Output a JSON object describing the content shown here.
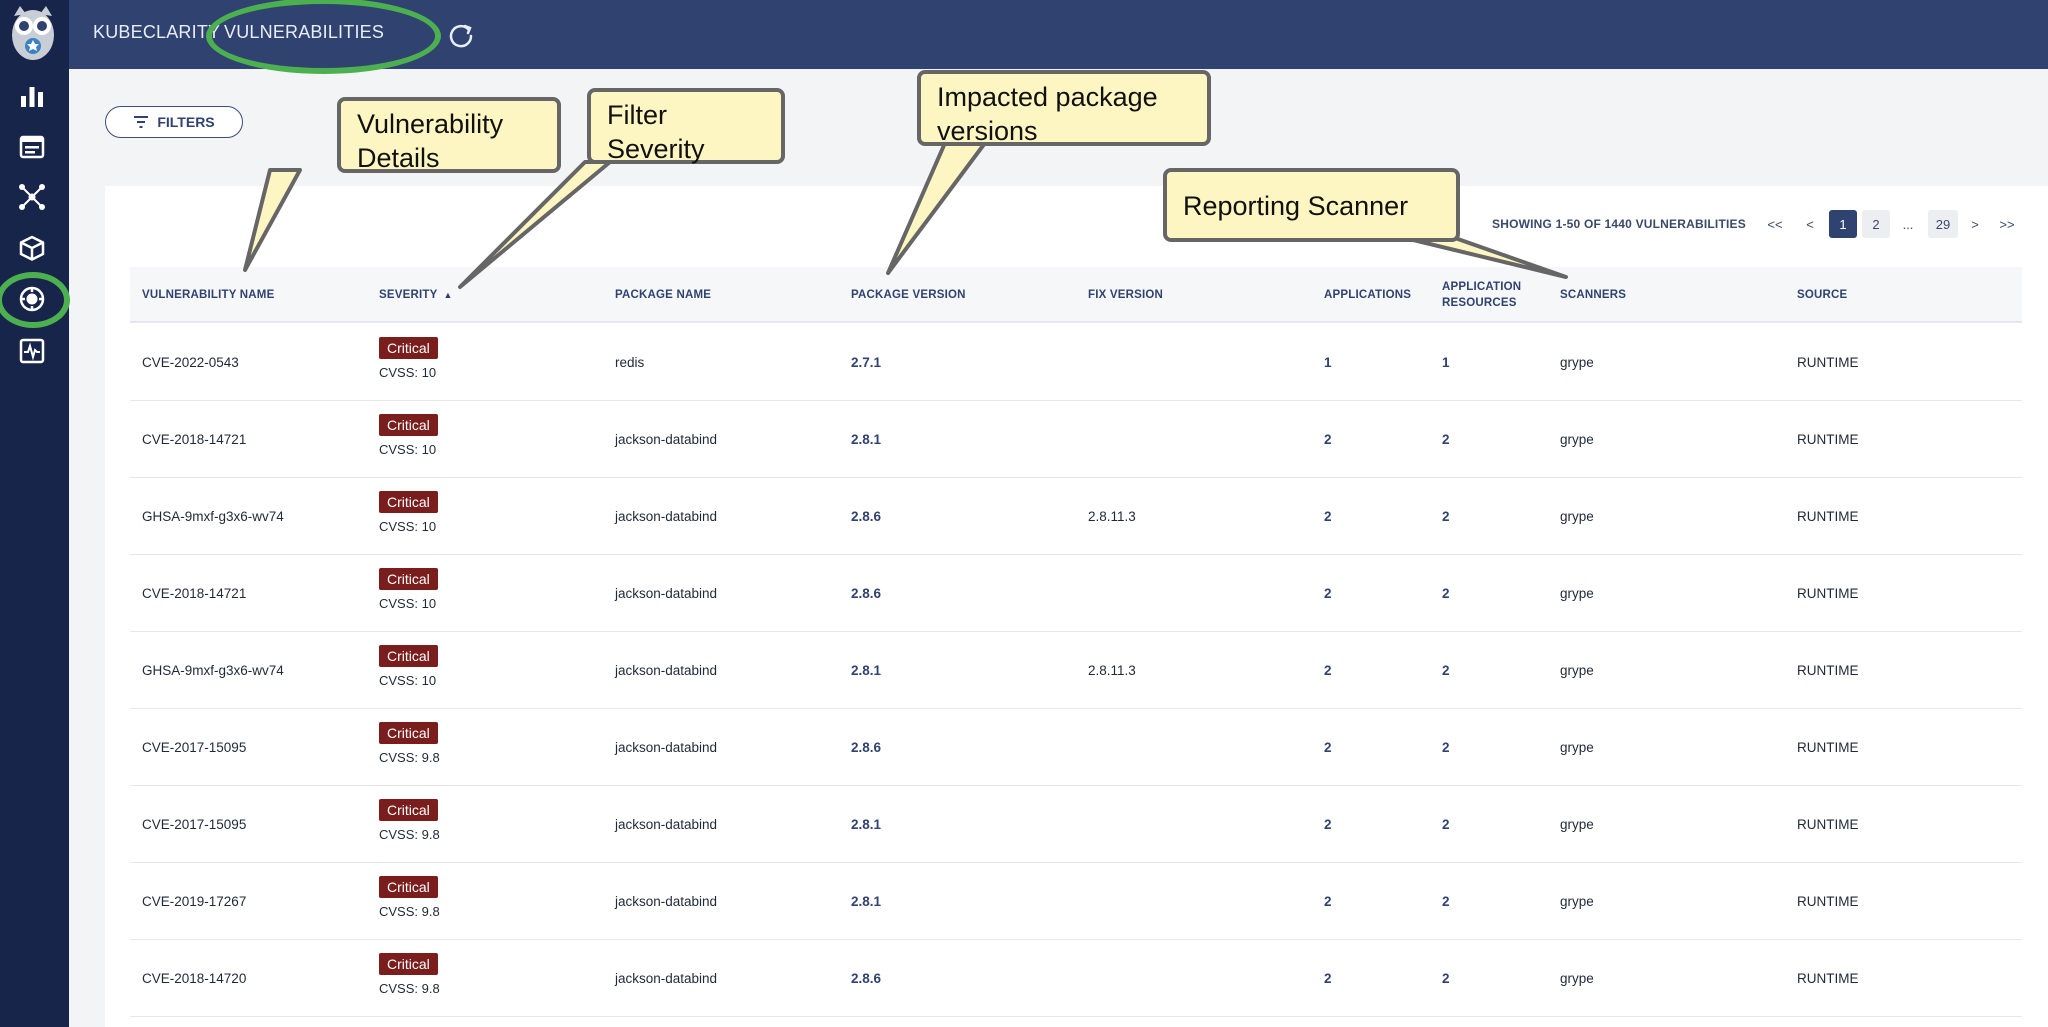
{
  "header": {
    "breadcrumb_root": "KUBECLARITY",
    "breadcrumb_current": "VULNERABILITIES"
  },
  "sidebar": {
    "items": [
      {
        "icon": "bar-chart-icon"
      },
      {
        "icon": "applications-icon"
      },
      {
        "icon": "network-icon"
      },
      {
        "icon": "package-icon"
      },
      {
        "icon": "vulnerability-icon",
        "active": true
      },
      {
        "icon": "runtime-scan-icon"
      }
    ]
  },
  "toolbar": {
    "filters_label": "FILTERS"
  },
  "pagination": {
    "summary": "SHOWING 1-50 OF 1440 VULNERABILITIES",
    "first": "<<",
    "prev": "<",
    "pages": [
      "1",
      "2",
      "...",
      "29"
    ],
    "active_page": "1",
    "next": ">",
    "last": ">>"
  },
  "table": {
    "columns": [
      "VULNERABILITY NAME",
      "SEVERITY",
      "PACKAGE NAME",
      "PACKAGE VERSION",
      "FIX VERSION",
      "APPLICATIONS",
      "APPLICATION RESOURCES",
      "SCANNERS",
      "SOURCE"
    ],
    "sort_indicator": "▲",
    "rows": [
      {
        "name": "CVE-2022-0543",
        "severity": "Critical",
        "cvss": "CVSS: 10",
        "package": "redis",
        "version": "2.7.1",
        "fix": "",
        "apps": "1",
        "resources": "1",
        "scanners": "grype",
        "source": "RUNTIME"
      },
      {
        "name": "CVE-2018-14721",
        "severity": "Critical",
        "cvss": "CVSS: 10",
        "package": "jackson-databind",
        "version": "2.8.1",
        "fix": "",
        "apps": "2",
        "resources": "2",
        "scanners": "grype",
        "source": "RUNTIME"
      },
      {
        "name": "GHSA-9mxf-g3x6-wv74",
        "severity": "Critical",
        "cvss": "CVSS: 10",
        "package": "jackson-databind",
        "version": "2.8.6",
        "fix": "2.8.11.3",
        "apps": "2",
        "resources": "2",
        "scanners": "grype",
        "source": "RUNTIME"
      },
      {
        "name": "CVE-2018-14721",
        "severity": "Critical",
        "cvss": "CVSS: 10",
        "package": "jackson-databind",
        "version": "2.8.6",
        "fix": "",
        "apps": "2",
        "resources": "2",
        "scanners": "grype",
        "source": "RUNTIME"
      },
      {
        "name": "GHSA-9mxf-g3x6-wv74",
        "severity": "Critical",
        "cvss": "CVSS: 10",
        "package": "jackson-databind",
        "version": "2.8.1",
        "fix": "2.8.11.3",
        "apps": "2",
        "resources": "2",
        "scanners": "grype",
        "source": "RUNTIME"
      },
      {
        "name": "CVE-2017-15095",
        "severity": "Critical",
        "cvss": "CVSS: 9.8",
        "package": "jackson-databind",
        "version": "2.8.6",
        "fix": "",
        "apps": "2",
        "resources": "2",
        "scanners": "grype",
        "source": "RUNTIME"
      },
      {
        "name": "CVE-2017-15095",
        "severity": "Critical",
        "cvss": "CVSS: 9.8",
        "package": "jackson-databind",
        "version": "2.8.1",
        "fix": "",
        "apps": "2",
        "resources": "2",
        "scanners": "grype",
        "source": "RUNTIME"
      },
      {
        "name": "CVE-2019-17267",
        "severity": "Critical",
        "cvss": "CVSS: 9.8",
        "package": "jackson-databind",
        "version": "2.8.1",
        "fix": "",
        "apps": "2",
        "resources": "2",
        "scanners": "grype",
        "source": "RUNTIME"
      },
      {
        "name": "CVE-2018-14720",
        "severity": "Critical",
        "cvss": "CVSS: 9.8",
        "package": "jackson-databind",
        "version": "2.8.6",
        "fix": "",
        "apps": "2",
        "resources": "2",
        "scanners": "grype",
        "source": "RUNTIME"
      }
    ]
  },
  "annotations": {
    "vuln_details": "Vulnerability Details",
    "filter_severity": "Filter Severity",
    "impacted_versions": "Impacted package versions",
    "reporting_scanner": "Reporting Scanner"
  },
  "colors": {
    "sidebar": "#17254a",
    "topbar": "#2f4270",
    "critical": "#7a1d1d",
    "highlight_ring": "#4caf50",
    "callout_fill": "#fdf6c3"
  }
}
